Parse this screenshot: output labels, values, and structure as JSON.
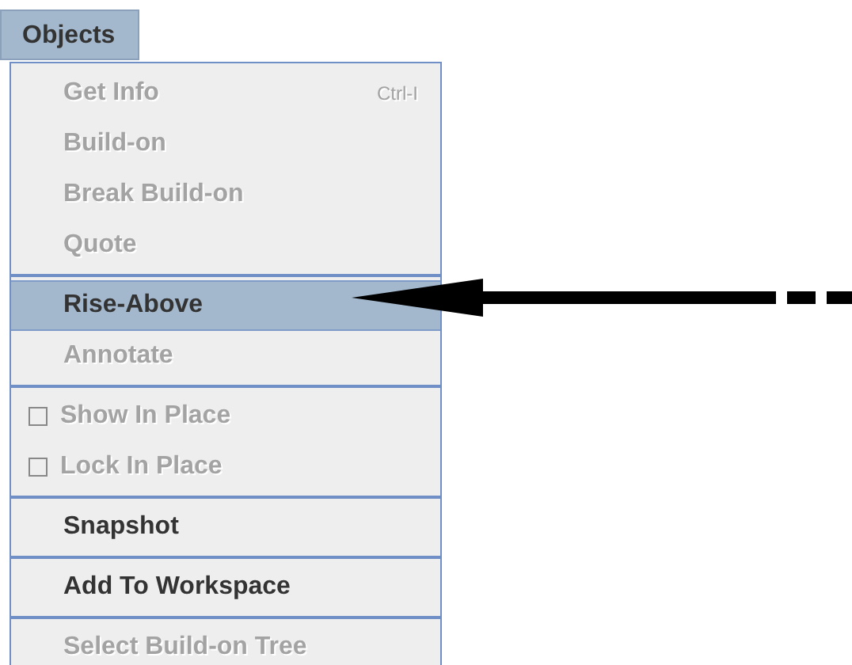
{
  "menu": {
    "title": "Objects",
    "open": true,
    "sections": [
      {
        "items": [
          {
            "kind": "command",
            "label": "Get Info",
            "shortcut": "Ctrl-I",
            "disabled": true,
            "selected": false
          },
          {
            "kind": "command",
            "label": "Build-on",
            "disabled": true,
            "selected": false
          },
          {
            "kind": "command",
            "label": "Break Build-on",
            "disabled": true,
            "selected": false
          },
          {
            "kind": "command",
            "label": "Quote",
            "disabled": true,
            "selected": false
          }
        ]
      },
      {
        "items": [
          {
            "kind": "command",
            "label": "Rise-Above",
            "disabled": false,
            "selected": true
          },
          {
            "kind": "command",
            "label": "Annotate",
            "disabled": true,
            "selected": false
          }
        ]
      },
      {
        "items": [
          {
            "kind": "checkbox",
            "label": "Show In Place",
            "checked": false,
            "disabled": true,
            "selected": false
          },
          {
            "kind": "checkbox",
            "label": "Lock In Place",
            "checked": false,
            "disabled": true,
            "selected": false
          }
        ]
      },
      {
        "items": [
          {
            "kind": "command",
            "label": "Snapshot",
            "disabled": false,
            "selected": false
          }
        ]
      },
      {
        "items": [
          {
            "kind": "command",
            "label": "Add To Workspace",
            "disabled": false,
            "selected": false
          }
        ]
      },
      {
        "items": [
          {
            "kind": "command",
            "label": "Select Build-on Tree",
            "disabled": true,
            "selected": false
          }
        ]
      }
    ]
  }
}
